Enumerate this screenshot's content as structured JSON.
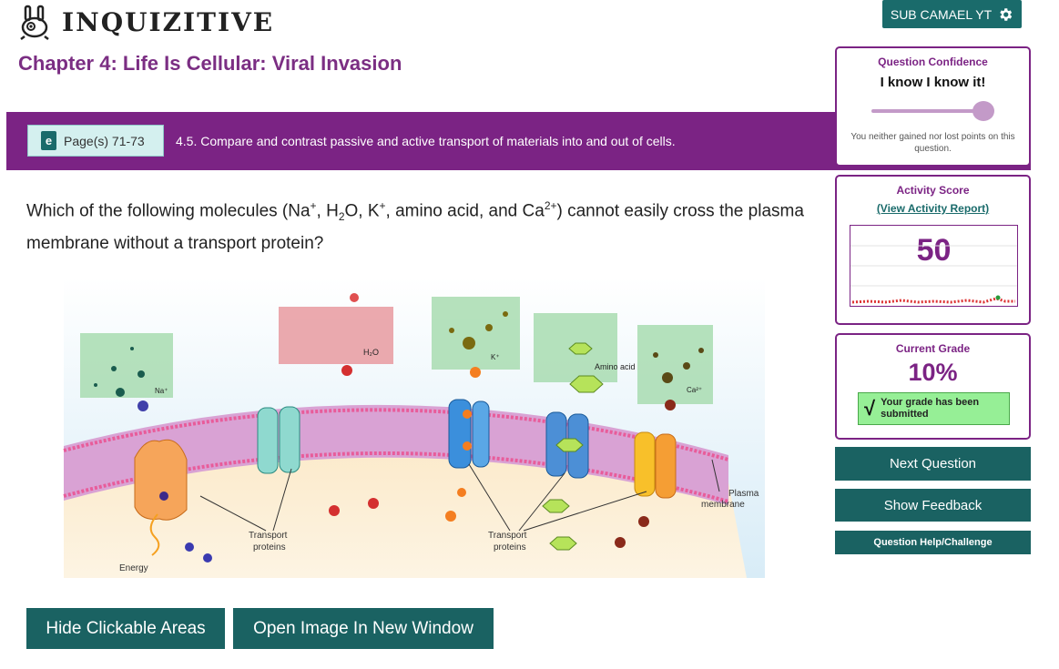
{
  "header": {
    "app_name": "INQUIZITIVE",
    "user_label": "SUB CAMAEL YT"
  },
  "chapter": {
    "title": "Chapter 4: Life Is Cellular: Viral Invasion"
  },
  "banner": {
    "pages_label": "Page(s) 71-73",
    "objective": "4.5. Compare and contrast passive and active transport of materials into and out of cells."
  },
  "question": {
    "part1": "Which of the following molecules (Na",
    "sup_na": "+",
    "part2": ", H",
    "sub_h2": "2",
    "part3": "O, K",
    "sup_k": "+",
    "part4": ", amino acid, and Ca",
    "sup_ca": "2+",
    "part5": ") cannot easily cross the plasma membrane without a transport protein?"
  },
  "diagram": {
    "labels": {
      "na": "Na⁺",
      "h2o": "H₂O",
      "k": "K⁺",
      "amino": "Amino acid",
      "ca": "Ca²⁺",
      "plasma1": "Plasma",
      "plasma2": "membrane",
      "tp_left1": "Transport",
      "tp_left2": "proteins",
      "tp_right1": "Transport",
      "tp_right2": "proteins",
      "energy": "Energy"
    }
  },
  "buttons": {
    "hide_areas": "Hide Clickable Areas",
    "open_image": "Open Image In New Window",
    "next": "Next Question",
    "feedback": "Show Feedback",
    "help": "Question Help/Challenge"
  },
  "confidence": {
    "title": "Question Confidence",
    "value": "I know I know it!",
    "note": "You neither gained nor lost points on this question."
  },
  "activity": {
    "title": "Activity Score",
    "link": "(View Activity Report)",
    "score": "50"
  },
  "grade": {
    "title": "Current Grade",
    "value": "10%",
    "submitted": "Your grade has been submitted"
  },
  "colors": {
    "brand_purple": "#7b2384",
    "teal": "#1a6262",
    "success_green": "#96ef96"
  },
  "icons": {
    "logo": "bunny-mascot-icon",
    "user": "gear-icon",
    "ebook": "ebook-icon",
    "check": "checkmark-icon"
  }
}
